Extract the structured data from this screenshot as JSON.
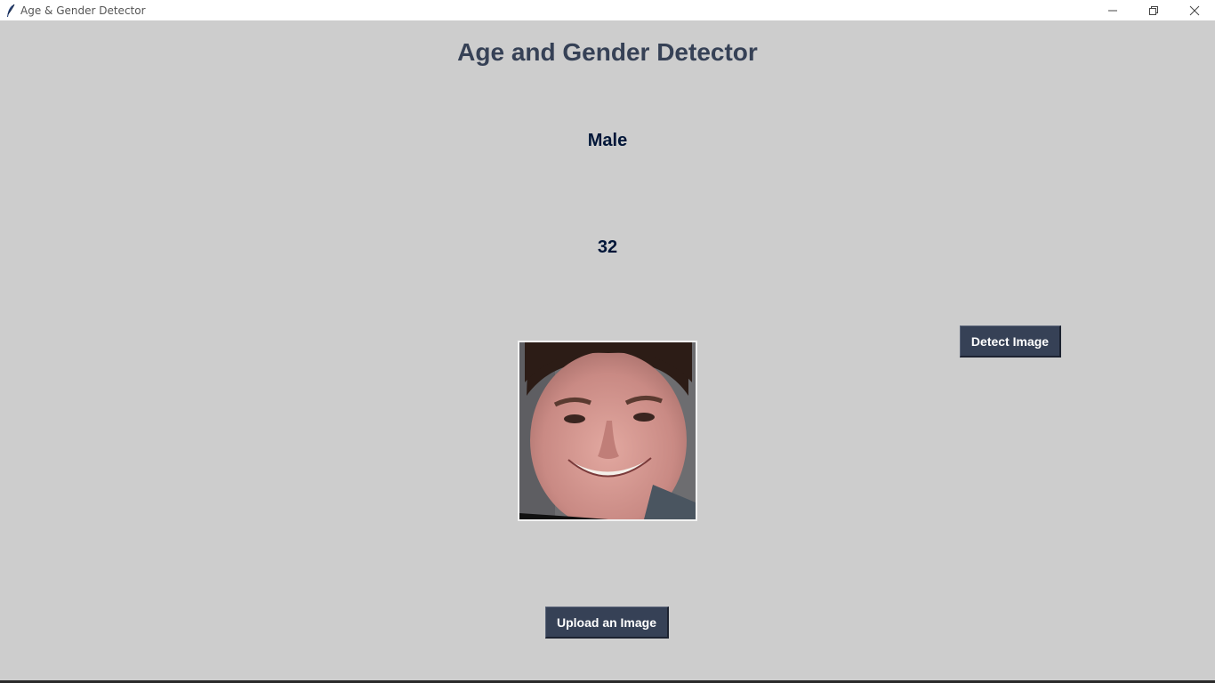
{
  "window": {
    "title": "Age & Gender Detector",
    "icon": "feather-icon",
    "controls": [
      "minimize-icon",
      "restore-icon",
      "close-icon"
    ]
  },
  "main": {
    "heading": "Age and Gender Detector",
    "gender": "Male",
    "age": "32",
    "photo": "face-photo"
  },
  "buttons": {
    "detect_label": "Detect Image",
    "upload_label": "Upload an Image"
  },
  "colors": {
    "background": "#cdcdcd",
    "heading": "#364156",
    "result_text": "#011638",
    "button_bg": "#364156",
    "button_text": "#ffffff"
  }
}
